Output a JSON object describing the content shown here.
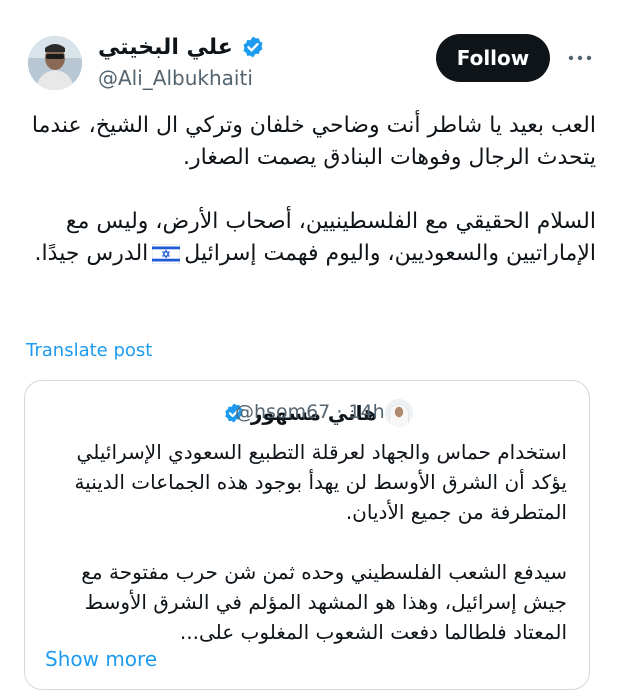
{
  "author": {
    "name": "علي البخيتي",
    "handle": "@Ali_Albukhaiti"
  },
  "follow_label": "Follow",
  "post": {
    "paragraph1": "العب بعيد يا شاطر أنت وضاحي خلفان وتركي ال الشيخ، عندما يتحدث الرجال وفوهات البنادق يصمت الصغار.",
    "paragraph2_before_flag": "السلام الحقيقي مع الفلسطينيين، أصحاب الأرض، وليس مع الإماراتيين والسعوديين، واليوم فهمت إسرائيل",
    "paragraph2_after_flag": "الدرس جيدًا."
  },
  "translate_label": "Translate post",
  "quote": {
    "name": "هاني مسهور",
    "handle": "@hsom67",
    "time": "· 14h",
    "paragraph1": "استخدام حماس والجهاد لعرقلة التطبيع السعودي الإسرائيلي يؤكد أن الشرق الأوسط لن يهدأ بوجود هذه الجماعات الدينية المتطرفة من جميع الأديان.",
    "paragraph2": "سيدفع الشعب الفلسطيني وحده ثمن شن حرب مفتوحة مع جيش إسرائيل، وهذا هو المشهد المؤلم في الشرق الأوسط المعتاد فلطالما دفعت الشعوب المغلوب على...",
    "show_more": "Show more"
  },
  "icons": {
    "verified": "verified-badge-icon",
    "more": "more-horizontal-icon",
    "flag": "israel-flag-emoji"
  },
  "colors": {
    "accent": "#1d9bf0",
    "button": "#0f1419",
    "secondary_text": "#536471",
    "border": "#cfd9de"
  }
}
